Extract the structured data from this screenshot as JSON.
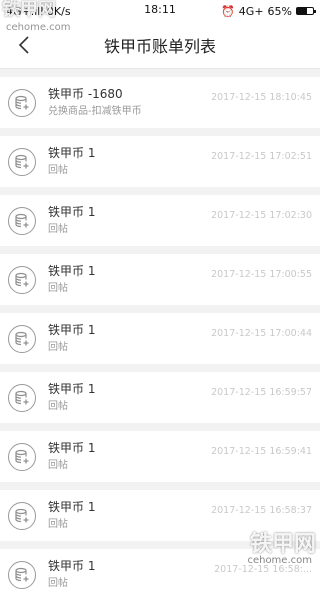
{
  "status_bar": {
    "left_text": "4G+.ıll 0K/s",
    "time": "18:11",
    "network": "4G+",
    "battery_percent": "65%",
    "battery_level": 0.65
  },
  "header": {
    "title": "铁甲币账单列表"
  },
  "watermark": {
    "top": "铁甲网",
    "top_sub": "cehome.com",
    "bottom": "铁甲网",
    "bottom_sub": "cehome.com"
  },
  "transactions": [
    {
      "amount": "铁甲币 -1680",
      "desc": "兑换商品-扣减铁甲币",
      "time": "2017-12-15 18:10:45"
    },
    {
      "amount": "铁甲币 1",
      "desc": "回帖",
      "time": "2017-12-15 17:02:51"
    },
    {
      "amount": "铁甲币 1",
      "desc": "回帖",
      "time": "2017-12-15 17:02:30"
    },
    {
      "amount": "铁甲币 1",
      "desc": "回帖",
      "time": "2017-12-15 17:00:55"
    },
    {
      "amount": "铁甲币 1",
      "desc": "回帖",
      "time": "2017-12-15 17:00:44"
    },
    {
      "amount": "铁甲币 1",
      "desc": "回帖",
      "time": "2017-12-15 16:59:57"
    },
    {
      "amount": "铁甲币 1",
      "desc": "回帖",
      "time": "2017-12-15 16:59:41"
    },
    {
      "amount": "铁甲币 1",
      "desc": "回帖",
      "time": "2017-12-15 16:58:37"
    },
    {
      "amount": "铁甲币 1",
      "desc": "回帖",
      "time": "2017-12-15 16:58:..."
    }
  ],
  "icons": {
    "back": "chevron-left-icon",
    "coin": "coin-stack-icon",
    "alarm": "alarm-clock-icon",
    "battery": "battery-icon"
  }
}
